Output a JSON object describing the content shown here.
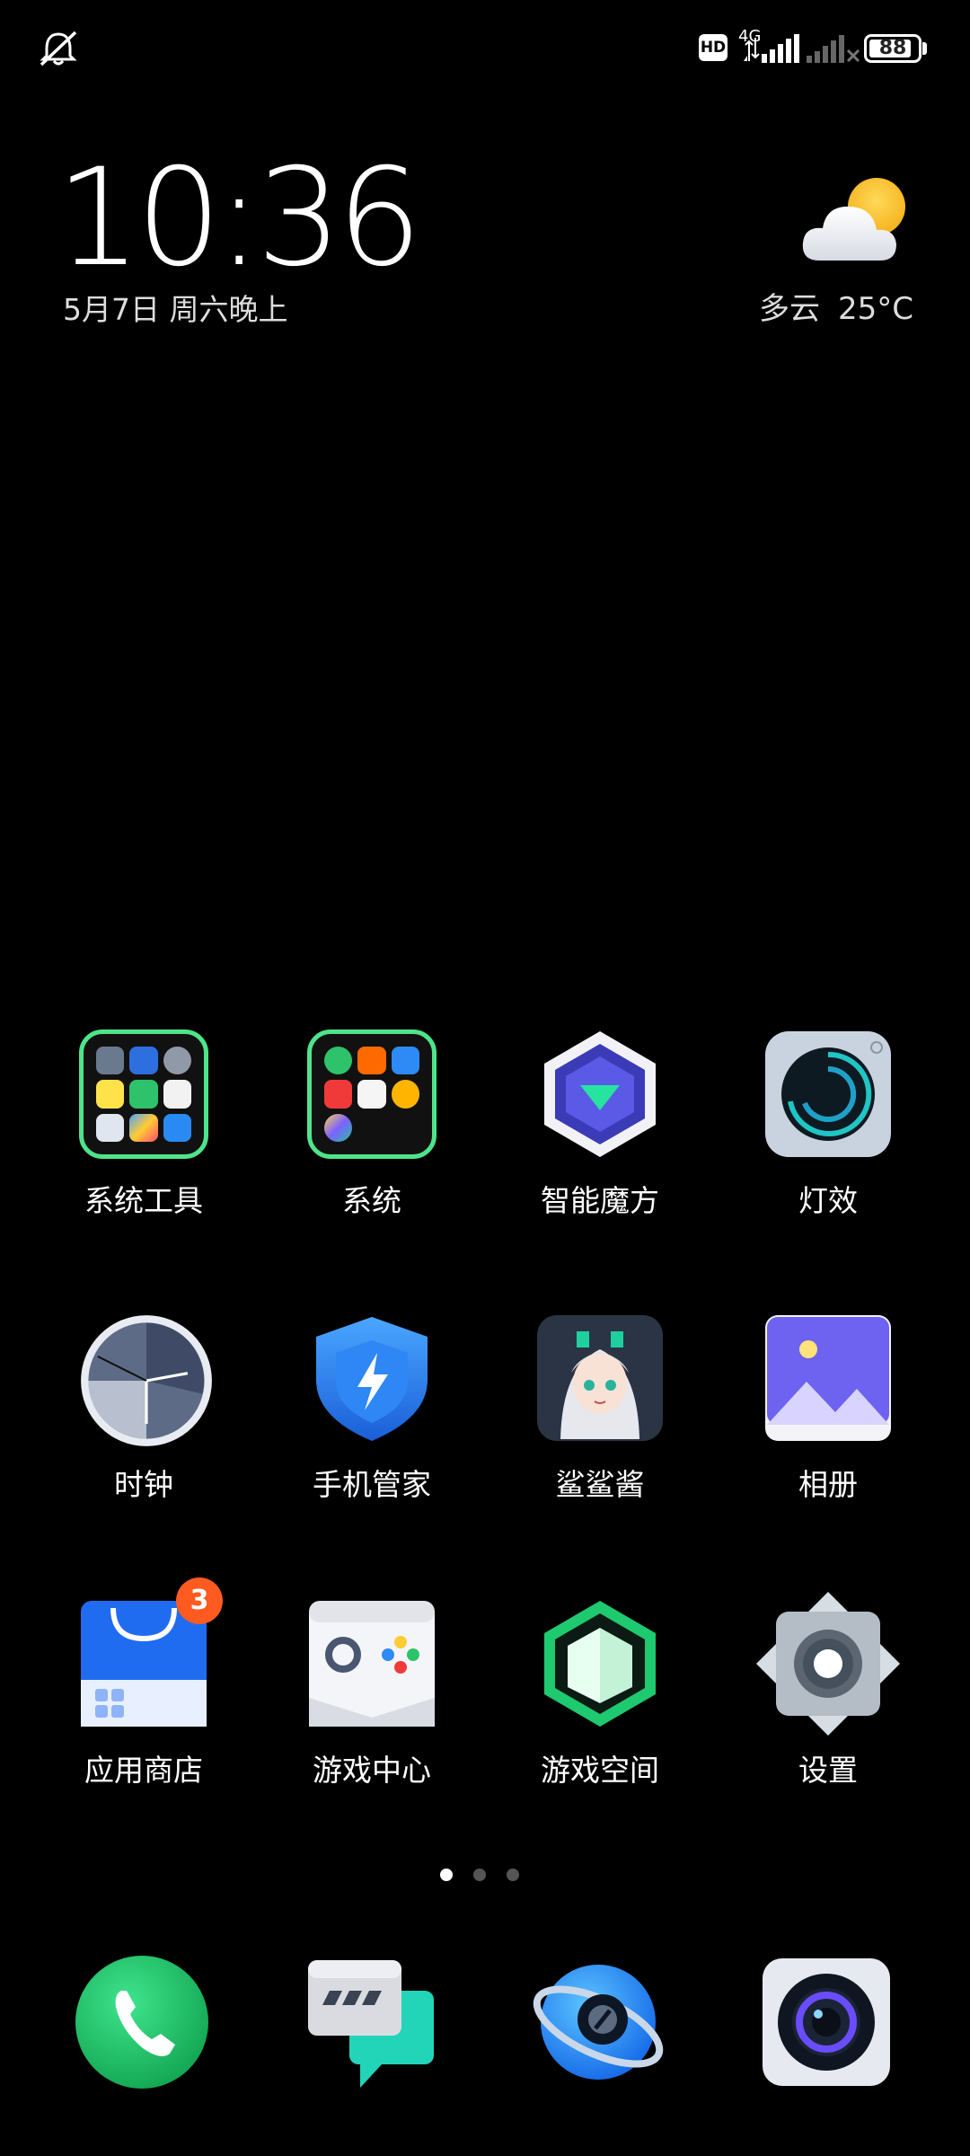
{
  "status_bar": {
    "hd": "HD",
    "network": "4G",
    "battery": "88",
    "battery_level": 0.88
  },
  "clock": {
    "time": "10:36",
    "date": "5月7日 周六晚上"
  },
  "weather": {
    "condition": "多云",
    "temperature": "25°C",
    "icon": "cloud-sun-icon"
  },
  "apps": [
    {
      "label": "系统工具",
      "icon": "folder-system-tools-icon"
    },
    {
      "label": "系统",
      "icon": "folder-system-icon"
    },
    {
      "label": "智能魔方",
      "icon": "smart-cube-icon"
    },
    {
      "label": "灯效",
      "icon": "light-effect-icon"
    },
    {
      "label": "时钟",
      "icon": "clock-icon"
    },
    {
      "label": "手机管家",
      "icon": "phone-manager-icon"
    },
    {
      "label": "鲨鲨酱",
      "icon": "anime-girl-icon"
    },
    {
      "label": "相册",
      "icon": "gallery-icon"
    },
    {
      "label": "应用商店",
      "icon": "app-store-icon",
      "badge": "3"
    },
    {
      "label": "游戏中心",
      "icon": "game-center-icon"
    },
    {
      "label": "游戏空间",
      "icon": "game-space-icon"
    },
    {
      "label": "设置",
      "icon": "settings-icon"
    }
  ],
  "page_indicator": {
    "count": 3,
    "active": 0
  },
  "dock": [
    {
      "icon": "phone-icon"
    },
    {
      "icon": "messages-icon"
    },
    {
      "icon": "browser-icon"
    },
    {
      "icon": "camera-icon"
    }
  ],
  "colors": {
    "folder_border": "#4ee48a",
    "badge": "#ff5a1f",
    "background": "#000000"
  }
}
